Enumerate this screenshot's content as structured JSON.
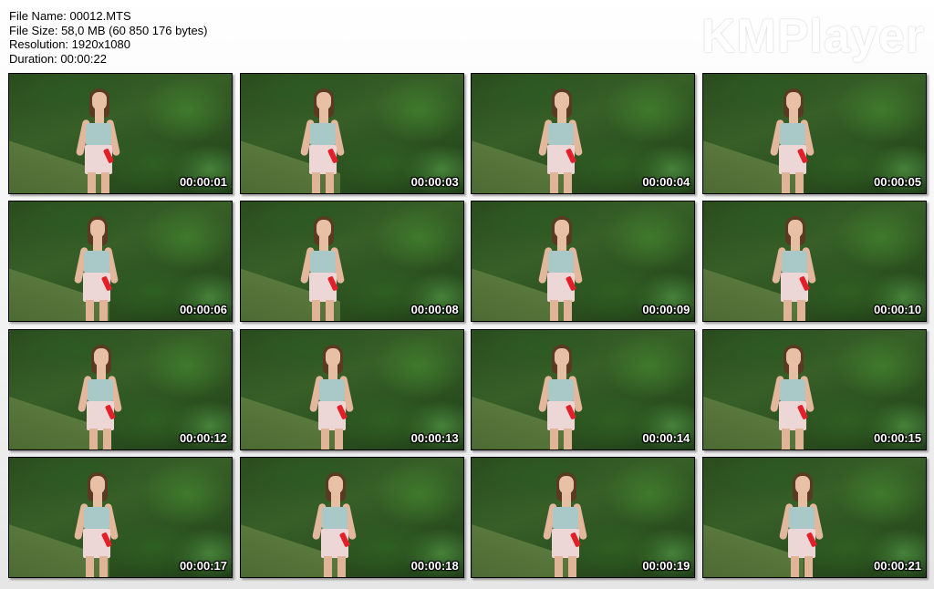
{
  "info": {
    "file_name": "File Name: 00012.MTS",
    "file_size": "File Size: 58,0 MB (60 850 176 bytes)",
    "resolution": "Resolution: 1920x1080",
    "duration": "Duration: 00:00:22"
  },
  "logo": "KMPlayer",
  "thumbnails": [
    {
      "time": "00:00:01"
    },
    {
      "time": "00:00:03"
    },
    {
      "time": "00:00:04"
    },
    {
      "time": "00:00:05"
    },
    {
      "time": "00:00:06"
    },
    {
      "time": "00:00:08"
    },
    {
      "time": "00:00:09"
    },
    {
      "time": "00:00:10"
    },
    {
      "time": "00:00:12"
    },
    {
      "time": "00:00:13"
    },
    {
      "time": "00:00:14"
    },
    {
      "time": "00:00:15"
    },
    {
      "time": "00:00:17"
    },
    {
      "time": "00:00:18"
    },
    {
      "time": "00:00:19"
    },
    {
      "time": "00:00:21"
    }
  ]
}
